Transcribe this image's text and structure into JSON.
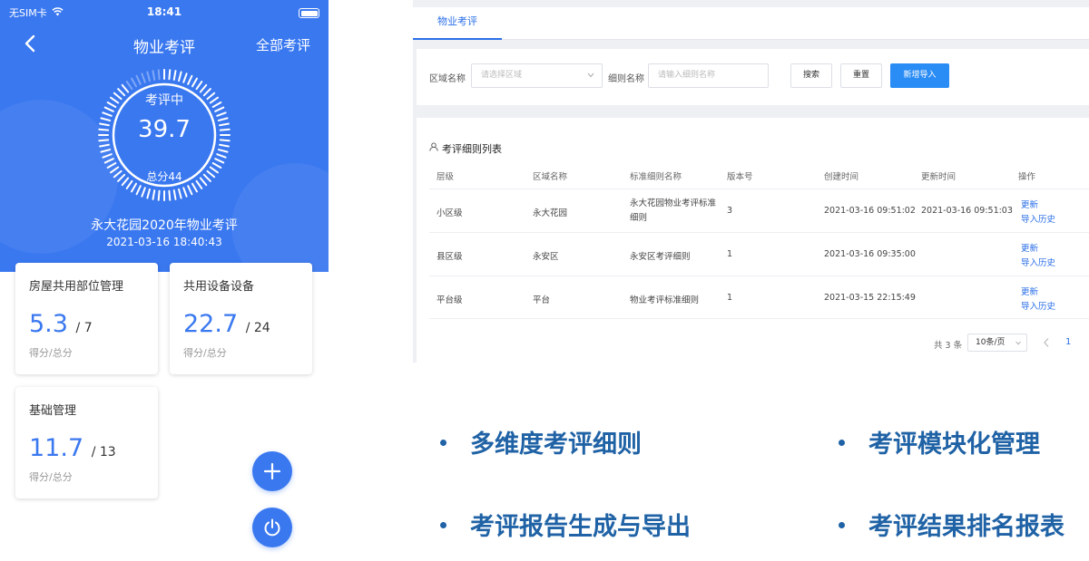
{
  "phone": {
    "status": {
      "carrier": "无SIM卡",
      "time": "18:41"
    },
    "nav": {
      "title": "物业考评",
      "right_link": "全部考评"
    },
    "gauge": {
      "label": "考评中",
      "value": "39.7",
      "total_text": "总分44",
      "progress_fraction": 0.9
    },
    "evaluation": {
      "name": "永大花园2020年物业考评",
      "date": "2021-03-16 18:40:43"
    },
    "cards": [
      {
        "title": "房屋共用部位管理",
        "score": "5.3",
        "total": "/ 7",
        "sub": "得分/总分"
      },
      {
        "title": "共用设备设备",
        "score": "22.7",
        "total": "/ 24",
        "sub": "得分/总分"
      },
      {
        "title": "基础管理",
        "score": "11.7",
        "total": "/ 13",
        "sub": "得分/总分"
      }
    ],
    "colors": {
      "primary": "#3a78f0"
    }
  },
  "web": {
    "tab": "物业考评",
    "filters": {
      "region_label": "区域名称",
      "region_placeholder": "请选择区域",
      "rule_label": "细则名称",
      "rule_placeholder": "请输入细则名称",
      "search": "搜索",
      "reset": "重置",
      "import": "新增导入"
    },
    "list_title": "考评细则列表",
    "columns": [
      "层级",
      "区域名称",
      "标准细则名称",
      "版本号",
      "创建时间",
      "更新时间",
      "操作"
    ],
    "rows": [
      {
        "level": "小区级",
        "region": "永大花园",
        "rule": "永大花园物业考评标准细则",
        "version": "3",
        "created": "2021-03-16 09:51:02",
        "updated": "2021-03-16 09:51:03",
        "op_update": "更新",
        "op_history": "导入历史"
      },
      {
        "level": "县区级",
        "region": "永安区",
        "rule": "永安区考评细则",
        "version": "1",
        "created": "2021-03-16 09:35:00",
        "updated": "",
        "op_update": "更新",
        "op_history": "导入历史"
      },
      {
        "level": "平台级",
        "region": "平台",
        "rule": "物业考评标准细则",
        "version": "1",
        "created": "2021-03-15 22:15:49",
        "updated": "",
        "op_update": "更新",
        "op_history": "导入历史"
      }
    ],
    "pagination": {
      "total": "共 3 条",
      "page_size": "10条/页",
      "current_page": "1"
    }
  },
  "features": [
    "多维度考评细则",
    "考评模块化管理",
    "考评报告生成与导出",
    "考评结果排名报表"
  ]
}
